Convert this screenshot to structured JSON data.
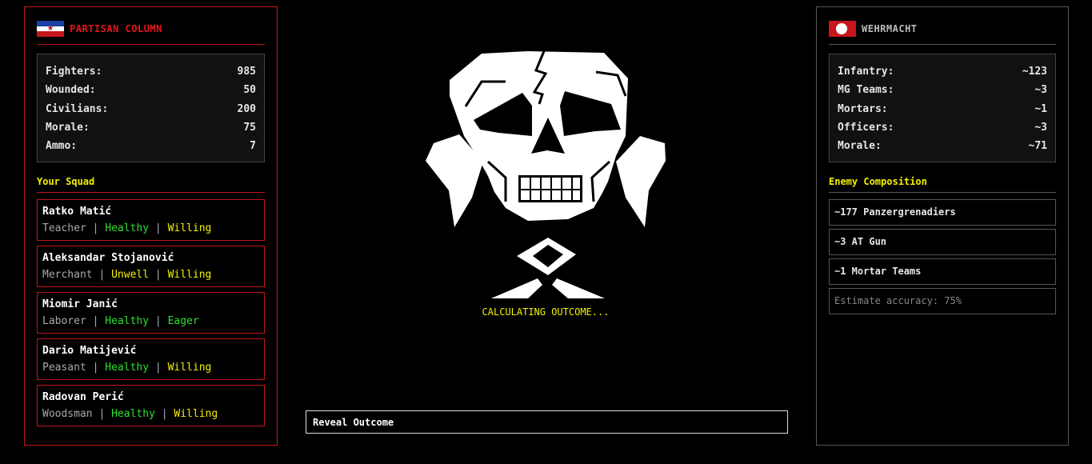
{
  "left": {
    "faction_name": "PARTISAN COLUMN",
    "stats": [
      {
        "label": "Fighters:",
        "value": "985"
      },
      {
        "label": "Wounded:",
        "value": "50"
      },
      {
        "label": "Civilians:",
        "value": "200"
      },
      {
        "label": "Morale:",
        "value": "75"
      },
      {
        "label": "Ammo:",
        "value": "7"
      }
    ],
    "squad_title": "Your Squad",
    "squad": [
      {
        "name": "Ratko Matić",
        "profession": "Teacher",
        "health": "Healthy",
        "attitude": "Willing"
      },
      {
        "name": "Aleksandar Stojanović",
        "profession": "Merchant",
        "health": "Unwell",
        "attitude": "Willing"
      },
      {
        "name": "Miomir Janić",
        "profession": "Laborer",
        "health": "Healthy",
        "attitude": "Eager"
      },
      {
        "name": "Dario Matijević",
        "profession": "Peasant",
        "health": "Healthy",
        "attitude": "Willing"
      },
      {
        "name": "Radovan Perić",
        "profession": "Woodsman",
        "health": "Healthy",
        "attitude": "Willing"
      }
    ],
    "separator": "|"
  },
  "right": {
    "faction_name": "WEHRMACHT",
    "stats": [
      {
        "label": "Infantry:",
        "value": "~123"
      },
      {
        "label": "MG Teams:",
        "value": "~3"
      },
      {
        "label": "Mortars:",
        "value": "~1"
      },
      {
        "label": "Officers:",
        "value": "~3"
      },
      {
        "label": "Morale:",
        "value": "~71"
      }
    ],
    "composition_title": "Enemy Composition",
    "composition": [
      "~177 Panzergrenadiers",
      "~3 AT Gun",
      "~1 Mortar Teams"
    ],
    "accuracy": "Estimate accuracy: 75%"
  },
  "center": {
    "status": "CALCULATING OUTCOME...",
    "reveal_label": "Reveal Outcome",
    "emblem_icon": "skull-icon"
  },
  "colors": {
    "accent_red": "#c0151b",
    "accent_yellow": "#f4f000",
    "healthy_green": "#2fe02f"
  }
}
